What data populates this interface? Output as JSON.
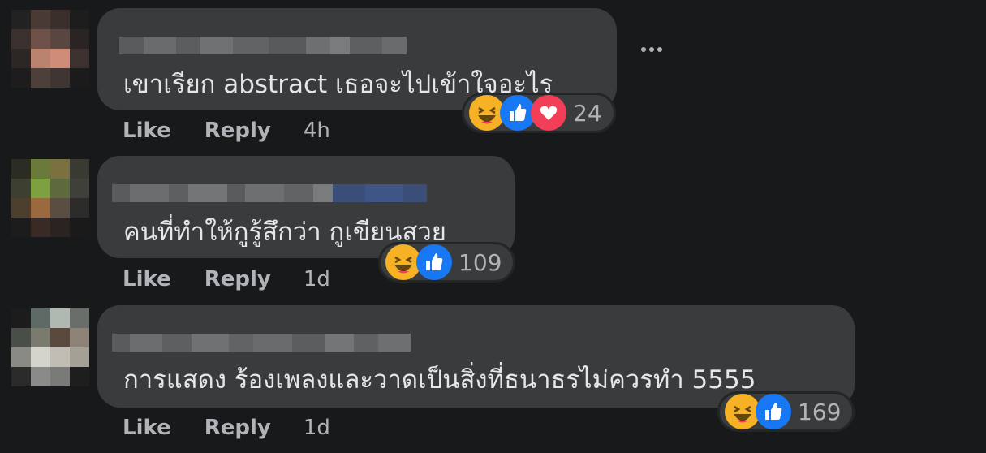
{
  "colors": {
    "background": "#18191a",
    "bubble": "#3a3b3c",
    "text": "#e4e6eb",
    "muted": "#b0b3b8",
    "haha": "#f7b125",
    "like": "#1877f2",
    "love": "#f33e58"
  },
  "comments": [
    {
      "text": "เขาเรียก abstract เธอจะไปเข้าใจอะไร",
      "like_label": "Like",
      "reply_label": "Reply",
      "time": "4h",
      "reactions": [
        "haha-icon",
        "like-icon",
        "love-icon"
      ],
      "reaction_count": "24"
    },
    {
      "text": "คนที่ทำให้กูรู้สึกว่า กูเขียนสวย",
      "like_label": "Like",
      "reply_label": "Reply",
      "time": "1d",
      "reactions": [
        "haha-icon",
        "like-icon"
      ],
      "reaction_count": "109"
    },
    {
      "text": "การแสดง ร้องเพลงและวาดเป็นสิ่งที่ธนาธรไม่ควรทำ 5555",
      "like_label": "Like",
      "reply_label": "Reply",
      "time": "1d",
      "reactions": [
        "haha-icon",
        "like-icon"
      ],
      "reaction_count": "169"
    }
  ]
}
